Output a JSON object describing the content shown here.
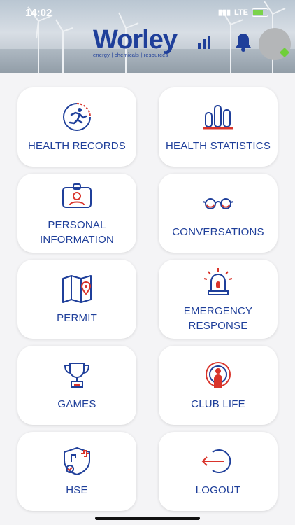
{
  "status_bar": {
    "time": "14:02",
    "network": "LTE"
  },
  "header": {
    "logo_name": "Worley",
    "logo_tagline": "energy | chemicals | resources",
    "icons": [
      "bell-icon",
      "avatar"
    ]
  },
  "colors": {
    "brand_blue": "#1f3f9a",
    "accent_red": "#d9342b"
  },
  "menu": [
    {
      "label": "HEALTH RECORDS",
      "icon": "runner-icon"
    },
    {
      "label": "HEALTH STATISTICS",
      "icon": "bar-chart-icon"
    },
    {
      "label": "PERSONAL\nINFORMATION",
      "icon": "id-card-icon"
    },
    {
      "label": "CONVERSATIONS",
      "icon": "glasses-icon"
    },
    {
      "label": "PERMIT",
      "icon": "map-pin-icon"
    },
    {
      "label": "EMERGENCY\nRESPONSE",
      "icon": "siren-icon"
    },
    {
      "label": "GAMES",
      "icon": "trophy-icon"
    },
    {
      "label": "CLUB LIFE",
      "icon": "club-person-icon"
    },
    {
      "label": "HSE",
      "icon": "shield-check-icon"
    },
    {
      "label": "LOGOUT",
      "icon": "logout-icon"
    }
  ]
}
